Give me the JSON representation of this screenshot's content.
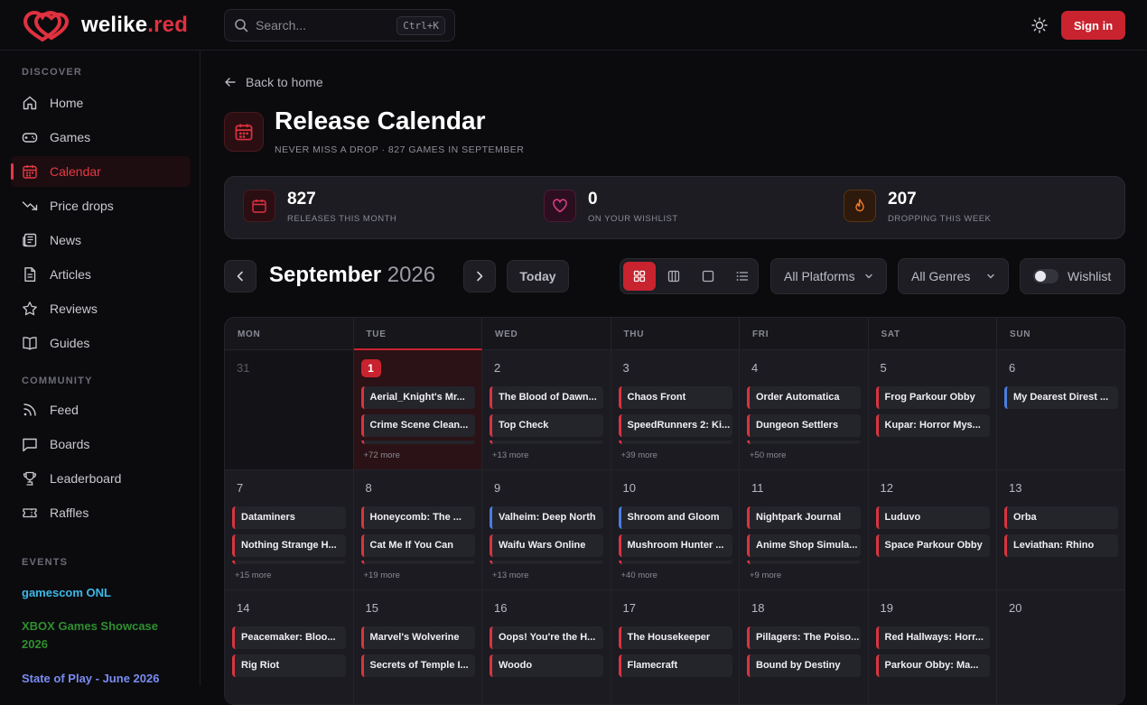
{
  "brand": {
    "name": "welike",
    "tld": ".red",
    "accent": "#e0313f"
  },
  "header": {
    "search_placeholder": "Search...",
    "shortcut": "Ctrl+K",
    "sign_in": "Sign in"
  },
  "sidebar": {
    "discover_label": "DISCOVER",
    "discover": [
      {
        "label": "Home",
        "icon": "home-icon"
      },
      {
        "label": "Games",
        "icon": "gamepad-icon"
      },
      {
        "label": "Calendar",
        "icon": "calendar-icon",
        "active": true
      },
      {
        "label": "Price drops",
        "icon": "trending-down-icon"
      },
      {
        "label": "News",
        "icon": "newspaper-icon"
      },
      {
        "label": "Articles",
        "icon": "document-icon"
      },
      {
        "label": "Reviews",
        "icon": "star-icon"
      },
      {
        "label": "Guides",
        "icon": "book-icon"
      }
    ],
    "community_label": "COMMUNITY",
    "community": [
      {
        "label": "Feed",
        "icon": "rss-icon"
      },
      {
        "label": "Boards",
        "icon": "chat-icon"
      },
      {
        "label": "Leaderboard",
        "icon": "trophy-icon"
      },
      {
        "label": "Raffles",
        "icon": "ticket-icon"
      }
    ],
    "events_label": "EVENTS",
    "events": [
      {
        "label": "gamescom ONL",
        "color": "#3db8e8"
      },
      {
        "label": "XBOX Games Showcase 2026",
        "color": "#2f8f2f"
      },
      {
        "label": "State of Play - June 2026",
        "color": "#7a8cf0"
      }
    ]
  },
  "page": {
    "back": "Back to home",
    "title": "Release Calendar",
    "subtitle": "NEVER MISS A DROP · 827 GAMES IN SEPTEMBER"
  },
  "stats": [
    {
      "value": "827",
      "label": "RELEASES THIS MONTH",
      "icon": "calendar-icon",
      "color": "#e0313f"
    },
    {
      "value": "0",
      "label": "ON YOUR WISHLIST",
      "icon": "heart-icon",
      "color": "#e0408a"
    },
    {
      "value": "207",
      "label": "DROPPING THIS WEEK",
      "icon": "flame-icon",
      "color": "#f07a2a"
    }
  ],
  "controls": {
    "month": "September",
    "year": "2026",
    "today": "Today",
    "views": [
      "grid-view-icon",
      "columns-view-icon",
      "single-view-icon",
      "list-view-icon"
    ],
    "platforms": "All Platforms",
    "genres": "All Genres",
    "wishlist": "Wishlist"
  },
  "calendar": {
    "weekdays": [
      "MON",
      "TUE",
      "WED",
      "THU",
      "FRI",
      "SAT",
      "SUN"
    ],
    "today_col": 1,
    "weeks": [
      [
        {
          "day": "31",
          "muted": true,
          "events": []
        },
        {
          "day": "1",
          "today": true,
          "events": [
            "Aerial_Knight's Mr...",
            "Crime Scene Clean..."
          ],
          "more": "+72 more"
        },
        {
          "day": "2",
          "events": [
            "The Blood of Dawn...",
            "Top Check"
          ],
          "more": "+13 more"
        },
        {
          "day": "3",
          "events": [
            "Chaos Front",
            "SpeedRunners 2: Ki..."
          ],
          "more": "+39 more"
        },
        {
          "day": "4",
          "events": [
            "Order Automatica",
            "Dungeon Settlers"
          ],
          "more": "+50 more"
        },
        {
          "day": "5",
          "events": [
            "Frog Parkour Obby",
            "Kupar: Horror Mys..."
          ]
        },
        {
          "day": "6",
          "events": [
            "My Dearest Direst ..."
          ],
          "blue": [
            0
          ]
        }
      ],
      [
        {
          "day": "7",
          "events": [
            "Dataminers",
            "Nothing Strange H..."
          ],
          "more": "+15 more"
        },
        {
          "day": "8",
          "events": [
            "Honeycomb: The ...",
            "Cat Me If You Can"
          ],
          "more": "+19 more"
        },
        {
          "day": "9",
          "events": [
            "Valheim: Deep North",
            "Waifu Wars Online"
          ],
          "more": "+13 more",
          "blue": [
            0
          ]
        },
        {
          "day": "10",
          "events": [
            "Shroom and Gloom",
            "Mushroom Hunter ..."
          ],
          "more": "+40 more",
          "blue": [
            0
          ]
        },
        {
          "day": "11",
          "events": [
            "Nightpark Journal",
            "Anime Shop Simula..."
          ],
          "more": "+9 more"
        },
        {
          "day": "12",
          "events": [
            "Luduvo",
            "Space Parkour Obby"
          ]
        },
        {
          "day": "13",
          "events": [
            "Orba",
            "Leviathan: Rhino"
          ]
        }
      ],
      [
        {
          "day": "14",
          "events": [
            "Peacemaker: Bloo...",
            "Rig Riot"
          ]
        },
        {
          "day": "15",
          "events": [
            "Marvel's Wolverine",
            "Secrets of Temple I..."
          ]
        },
        {
          "day": "16",
          "events": [
            "Oops! You're the H...",
            "Woodo"
          ]
        },
        {
          "day": "17",
          "events": [
            "The Housekeeper",
            "Flamecraft"
          ]
        },
        {
          "day": "18",
          "events": [
            "Pillagers: The Poiso...",
            "Bound by Destiny"
          ]
        },
        {
          "day": "19",
          "events": [
            "Red Hallways: Horr...",
            "Parkour Obby: Ma..."
          ]
        },
        {
          "day": "20",
          "events": []
        }
      ]
    ]
  }
}
